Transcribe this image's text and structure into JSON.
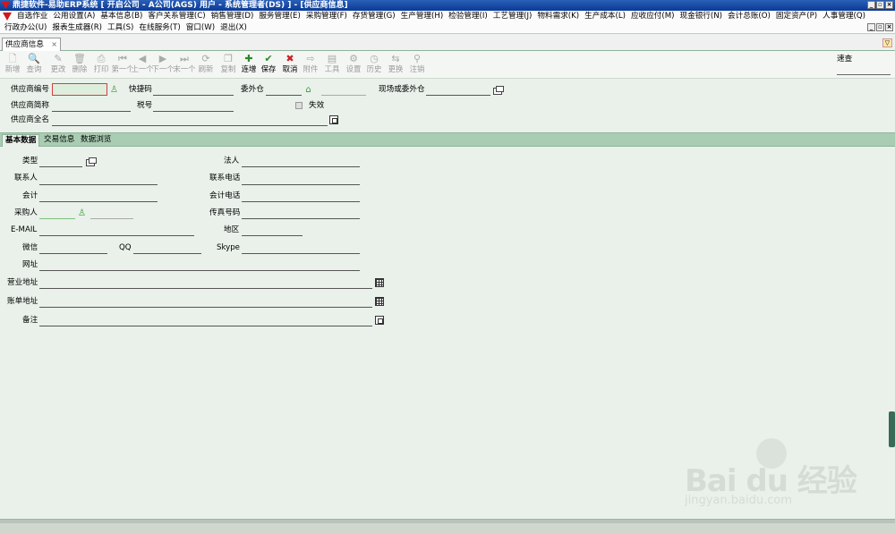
{
  "window": {
    "title": "鼎捷软件-易助ERP系统   [ 开启公司 - A公司(AGS)    用户 - 系统管理者(DS) ] - [供应商信息]"
  },
  "menu": {
    "row1": [
      "自选作业",
      "公用设置(A)",
      "基本信息(B)",
      "客户关系管理(C)",
      "销售管理(D)",
      "服务管理(E)",
      "采购管理(F)",
      "存货管理(G)",
      "生产管理(H)",
      "检验管理(I)",
      "工艺管理(J)",
      "物料需求(K)",
      "生产成本(L)",
      "应收应付(M)",
      "现金银行(N)",
      "会计总账(O)",
      "固定资产(P)",
      "人事管理(Q)"
    ],
    "row2": [
      "行政办公(U)",
      "报表生成器(R)",
      "工具(S)",
      "在线服务(T)",
      "窗口(W)",
      "退出(X)"
    ]
  },
  "doc_tab": {
    "label": "供应商信息",
    "close": "×"
  },
  "toolbar": {
    "buttons": [
      {
        "icon": "new-icon",
        "glyph": "🗋",
        "label": "新增",
        "enabled": false
      },
      {
        "icon": "query-icon",
        "glyph": "🔍",
        "label": "查询",
        "enabled": false
      },
      {
        "icon": "edit-icon",
        "glyph": "✎",
        "label": "更改",
        "enabled": false
      },
      {
        "icon": "delete-icon",
        "glyph": "🗑",
        "label": "删除",
        "enabled": false
      },
      {
        "icon": "print-icon",
        "glyph": "⎙",
        "label": "打印",
        "enabled": false
      },
      {
        "icon": "first-icon",
        "glyph": "⏮",
        "label": "第一个",
        "enabled": false
      },
      {
        "icon": "prev-icon",
        "glyph": "◀",
        "label": "上一个",
        "enabled": false
      },
      {
        "icon": "next-icon",
        "glyph": "▶",
        "label": "下一个",
        "enabled": false
      },
      {
        "icon": "last-icon",
        "glyph": "⏭",
        "label": "末一个",
        "enabled": false
      },
      {
        "icon": "refresh-icon",
        "glyph": "⟳",
        "label": "刷新",
        "enabled": false
      },
      {
        "icon": "copy-icon",
        "glyph": "❐",
        "label": "复制",
        "enabled": false
      },
      {
        "icon": "continuous-add-icon",
        "glyph": "✚",
        "label": "连增",
        "enabled": true
      },
      {
        "icon": "save-icon",
        "glyph": "✔",
        "label": "保存",
        "enabled": true
      },
      {
        "icon": "cancel-icon",
        "glyph": "✖",
        "label": "取消",
        "enabled": true
      },
      {
        "icon": "attachment-icon",
        "glyph": "⇨",
        "label": "附件",
        "enabled": false
      },
      {
        "icon": "tools-icon",
        "glyph": "▤",
        "label": "工具",
        "enabled": false
      },
      {
        "icon": "settings-icon",
        "glyph": "⚙",
        "label": "设置",
        "enabled": false
      },
      {
        "icon": "history-icon",
        "glyph": "◷",
        "label": "历史",
        "enabled": false
      },
      {
        "icon": "replace-icon",
        "glyph": "⇆",
        "label": "更换",
        "enabled": false
      },
      {
        "icon": "logout-icon",
        "glyph": "⚲",
        "label": "注销",
        "enabled": false
      }
    ],
    "quick_search_label": "速查"
  },
  "header_form": {
    "supplier_code_label": "供应商编号",
    "quick_code_label": "快捷码",
    "outsource_wh_label": "委外仓",
    "site_wh_label": "现场或委外仓",
    "short_name_label": "供应商简称",
    "tax_no_label": "税号",
    "invalid_label": "失效",
    "full_name_label": "供应商全名"
  },
  "subtabs": [
    "基本数据",
    "交易信息",
    "数据浏览"
  ],
  "basic": {
    "type_label": "类型",
    "legal_label": "法人",
    "contact_label": "联系人",
    "contact_phone_label": "联系电话",
    "accountant_label": "会计",
    "accountant_phone_label": "会计电话",
    "buyer_label": "采购人",
    "fax_label": "传真号码",
    "email_label": "E-MAIL",
    "region_label": "地区",
    "wechat_label": "微信",
    "qq_label": "QQ",
    "skype_label": "Skype",
    "website_label": "网址",
    "business_addr_label": "营业地址",
    "bill_addr_label": "账单地址",
    "remark_label": "备注"
  },
  "watermark": {
    "brand": "Bai du 经验",
    "url": "jingyan.baidu.com"
  }
}
